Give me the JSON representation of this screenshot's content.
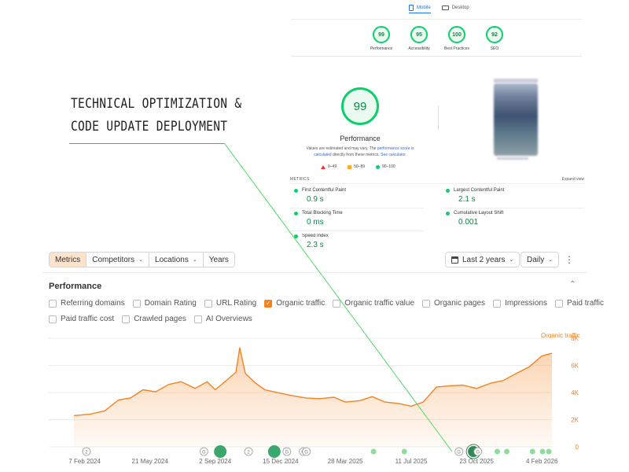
{
  "lighthouse": {
    "tabs": [
      {
        "label": "Mobile",
        "icon": "mobile-icon",
        "active": true
      },
      {
        "label": "Desktop",
        "icon": "desktop-icon",
        "active": false
      }
    ],
    "scores": [
      {
        "value": "99",
        "label": "Performance"
      },
      {
        "value": "95",
        "label": "Accessibility"
      },
      {
        "value": "100",
        "label": "Best Practices"
      },
      {
        "value": "92",
        "label": "SEO"
      }
    ],
    "main_score": "99",
    "main_title": "Performance",
    "note_prefix": "Values are estimated and may vary. The ",
    "note_link1": "performance score is calculated",
    "note_middle": " directly from these metrics. ",
    "note_link2": "See calculator.",
    "legend": [
      "0–49",
      "50–89",
      "90–100"
    ],
    "metrics_header": "METRICS",
    "expand_view": "Expand view",
    "metrics": [
      {
        "name": "First Contentful Paint",
        "value": "0.9 s"
      },
      {
        "name": "Largest Contentful Paint",
        "value": "2.1 s"
      },
      {
        "name": "Total Blocking Time",
        "value": "0 ms"
      },
      {
        "name": "Cumulative Layout Shift",
        "value": "0.001"
      },
      {
        "name": "Speed Index",
        "value": "2.3 s"
      }
    ],
    "colors": {
      "good": "#0cce6b",
      "average": "#ffaa33",
      "poor": "#ff3333"
    }
  },
  "annotation": {
    "line1": "TECHNICAL OPTIMIZATION &",
    "line2": "CODE UPDATE DEPLOYMENT"
  },
  "toolbar": {
    "tabs": [
      {
        "label": "Metrics",
        "active": true,
        "dropdown": false
      },
      {
        "label": "Competitors",
        "active": false,
        "dropdown": true
      },
      {
        "label": "Locations",
        "active": false,
        "dropdown": true
      },
      {
        "label": "Years",
        "active": false,
        "dropdown": false
      }
    ],
    "date_range": "Last 2 years",
    "interval": "Daily"
  },
  "performance": {
    "title": "Performance",
    "checkboxes_row1": [
      {
        "label": "Referring domains",
        "checked": false
      },
      {
        "label": "Domain Rating",
        "checked": false
      },
      {
        "label": "URL Rating",
        "checked": false
      },
      {
        "label": "Organic traffic",
        "checked": true
      },
      {
        "label": "Organic traffic value",
        "checked": false
      },
      {
        "label": "Organic pages",
        "checked": false
      },
      {
        "label": "Impressions",
        "checked": false
      },
      {
        "label": "Paid traffic",
        "checked": false
      }
    ],
    "checkboxes_row2": [
      {
        "label": "Paid traffic cost",
        "checked": false
      },
      {
        "label": "Crawled pages",
        "checked": false
      },
      {
        "label": "AI Overviews",
        "checked": false
      }
    ]
  },
  "chart_data": {
    "type": "area",
    "series": [
      {
        "name": "Organic traffic",
        "color": "#f5821f",
        "x": [
          "2024-01-21",
          "2024-02-15",
          "2024-03-10",
          "2024-04-01",
          "2024-04-20",
          "2024-05-10",
          "2024-05-30",
          "2024-06-20",
          "2024-07-10",
          "2024-08-01",
          "2024-08-20",
          "2024-09-02",
          "2024-09-20",
          "2024-10-05",
          "2024-10-11",
          "2024-10-20",
          "2024-11-05",
          "2024-11-20",
          "2024-12-15",
          "2025-01-05",
          "2025-01-25",
          "2025-02-15",
          "2025-03-10",
          "2025-03-28",
          "2025-04-20",
          "2025-05-10",
          "2025-05-30",
          "2025-06-20",
          "2025-07-11",
          "2025-07-30",
          "2025-08-20",
          "2025-09-10",
          "2025-10-01",
          "2025-10-23",
          "2025-11-15",
          "2025-12-05",
          "2025-12-25",
          "2026-01-15",
          "2026-02-04",
          "2026-02-20"
        ],
        "y": [
          2300,
          2400,
          2650,
          3450,
          3600,
          4200,
          4050,
          4600,
          4800,
          4300,
          4800,
          4200,
          4900,
          5500,
          7300,
          5400,
          4700,
          4200,
          3950,
          3750,
          3600,
          3550,
          3650,
          3300,
          3400,
          3700,
          3300,
          3200,
          3000,
          3300,
          4400,
          4500,
          4550,
          4300,
          4700,
          4900,
          5400,
          5900,
          6700,
          6900
        ]
      }
    ],
    "x_ticks": [
      "7 Feb 2024",
      "21 May 2024",
      "2 Sep 2024",
      "15 Dec 2024",
      "28 Mar 2025",
      "11 Jul 2025",
      "23 Oct 2025",
      "4 Feb 2026"
    ],
    "y_ticks": [
      "0",
      "2K",
      "4K",
      "6K",
      "8K"
    ],
    "ylim": [
      0,
      8000
    ],
    "xlim": [
      "2024-01-21",
      "2026-02-20"
    ],
    "grid": true,
    "series_label": "Organic traffic",
    "markers": [
      {
        "date": "2024-02-10",
        "label": "2",
        "kind": "hollow"
      },
      {
        "date": "2024-08-15",
        "label": "G",
        "kind": "hollow"
      },
      {
        "date": "2024-09-10",
        "label": "",
        "kind": "big-green"
      },
      {
        "date": "2024-10-25",
        "label": "2",
        "kind": "hollow"
      },
      {
        "date": "2024-12-05",
        "label": "",
        "kind": "big-green"
      },
      {
        "date": "2024-12-25",
        "label": "G",
        "kind": "hollow"
      },
      {
        "date": "2025-01-20",
        "label": "G",
        "kind": "hollow"
      },
      {
        "date": "2025-01-25",
        "label": "G",
        "kind": "hollow"
      },
      {
        "date": "2025-05-12",
        "label": "",
        "kind": "small-green"
      },
      {
        "date": "2025-06-30",
        "label": "",
        "kind": "small-green"
      },
      {
        "date": "2025-09-25",
        "label": "G",
        "kind": "hollow"
      },
      {
        "date": "2025-10-18",
        "label": "",
        "kind": "highlight"
      },
      {
        "date": "2025-10-25",
        "label": "G",
        "kind": "hollow"
      },
      {
        "date": "2025-11-25",
        "label": "",
        "kind": "small-green"
      },
      {
        "date": "2025-12-10",
        "label": "",
        "kind": "small-green"
      },
      {
        "date": "2026-01-20",
        "label": "",
        "kind": "small-green"
      },
      {
        "date": "2026-02-05",
        "label": "",
        "kind": "small-green"
      },
      {
        "date": "2026-02-15",
        "label": "",
        "kind": "small-green"
      }
    ]
  }
}
